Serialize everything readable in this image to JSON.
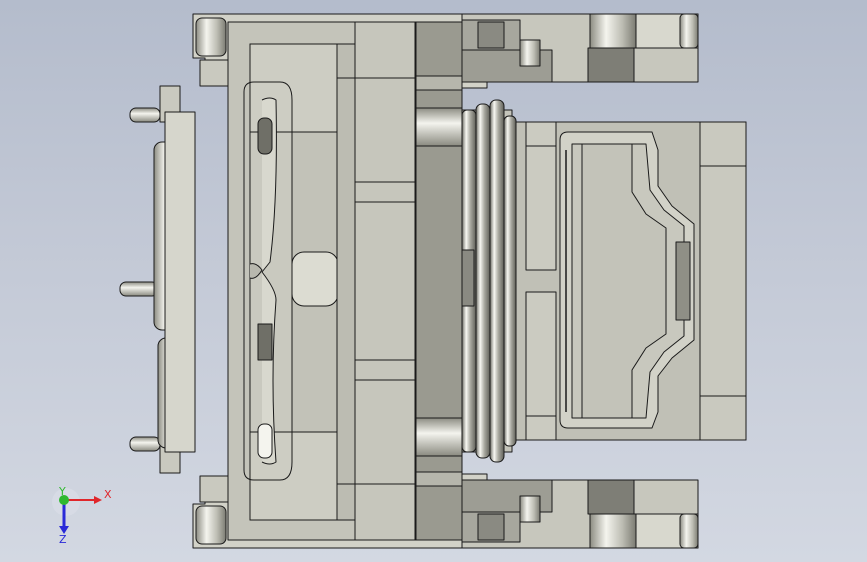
{
  "viewport": {
    "background_top": "#b4bccc",
    "background_bottom": "#d3d8e2",
    "part_fill": "#c9c9bf",
    "part_light": "#e4e4dc",
    "part_dark": "#8e8e84",
    "edge_color": "#1a1a1a"
  },
  "triad": {
    "x_label": "X",
    "y_label": "Y",
    "z_label": "Z",
    "x_color": "#e0262b",
    "y_color": "#2fb82f",
    "z_color": "#2a2ad8"
  }
}
